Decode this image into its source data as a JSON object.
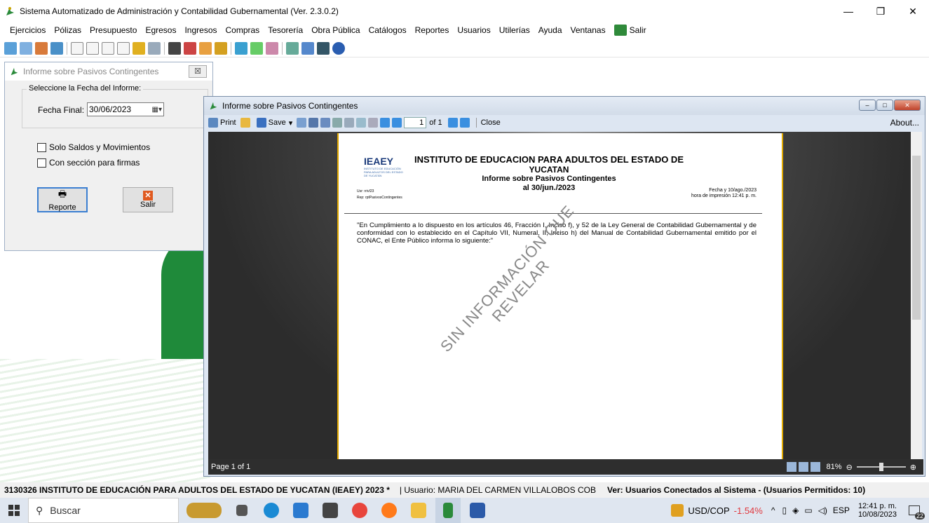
{
  "app": {
    "title": "Sistema Automatizado de Administración y Contabilidad Gubernamental  (Ver. 2.3.0.2)",
    "win_min": "—",
    "win_max": "❐",
    "win_close": "✕"
  },
  "menu": [
    "Ejercicios",
    "Pólizas",
    "Presupuesto",
    "Egresos",
    "Ingresos",
    "Compras",
    "Tesorería",
    "Obra Pública",
    "Catálogos",
    "Reportes",
    "Usuarios",
    "Utilerías",
    "Ayuda",
    "Ventanas",
    "Salir"
  ],
  "dialog": {
    "title": "Informe sobre Pasivos Contingentes",
    "close": "☒",
    "group_label": "Seleccione la Fecha del Informe:",
    "fecha_label": "Fecha Final:",
    "fecha_value": "30/06/2023",
    "chk1": "Solo Saldos y Movimientos",
    "chk2": "Con sección para firmas",
    "btn_reporte": "Reporte",
    "btn_salir": "Salir"
  },
  "report_window": {
    "title": "Informe sobre Pasivos Contingentes",
    "toolbar": {
      "print": "Print",
      "save": "Save",
      "page_value": "1",
      "of_pages": "of 1",
      "close": "Close",
      "about": "About..."
    },
    "status_page": "Page 1 of 1",
    "zoom": "81%"
  },
  "page": {
    "logo": "IEAEY",
    "logo_sub": "INSTITUTO DE EDUCACIÓN PARA ADULTOS DEL ESTADO DE YUCATÁN",
    "heading1": "INSTITUTO DE EDUCACION PARA ADULTOS DEL ESTADO DE",
    "heading2": "YUCATAN",
    "heading3": "Informe sobre Pasivos Contingentes",
    "heading4": "al 30/jun./2023",
    "usr": "Usr: rrivI23",
    "rep": "Rep: rptPasivosContingentes",
    "fecha_line": "Fecha y 10/ago./2023",
    "hora_line": "hora de impresión  12:41 p. m.",
    "body": "\"En Cumplimiento a lo dispuesto en los artículos 46, Fracción I, Inciso f), y 52 de la Ley General de Contabilidad Gubernamental y de conformidad con lo establecido en el Capítulo VII, Numeral, II, Inciso h) del Manual de Contabilidad Gubernamental emitido por el CONAC, el Ente Público informa lo siguiente:\"",
    "watermark1": "SIN INFORMACIÓN QUE",
    "watermark2": "REVELAR"
  },
  "app_status": {
    "entity": "3130326 INSTITUTO DE EDUCACIÓN PARA ADULTOS DEL ESTADO DE YUCATAN (IEAEY)  2023  *",
    "user": "| Usuario: MARIA DEL CARMEN VILLALOBOS COB",
    "connected": "Ver: Usuarios Conectados al Sistema - (Usuarios Permitidos: 10)"
  },
  "taskbar": {
    "search": "Buscar",
    "currency": "USD/COP",
    "currency_change": "-1.54%",
    "lang": "ESP",
    "time": "12:41 p. m.",
    "date": "10/08/2023",
    "notif": "22"
  },
  "colors": {
    "green": "#1f8a3a",
    "currency_red": "#e0393e",
    "accent_blue": "#3b7fd1"
  }
}
